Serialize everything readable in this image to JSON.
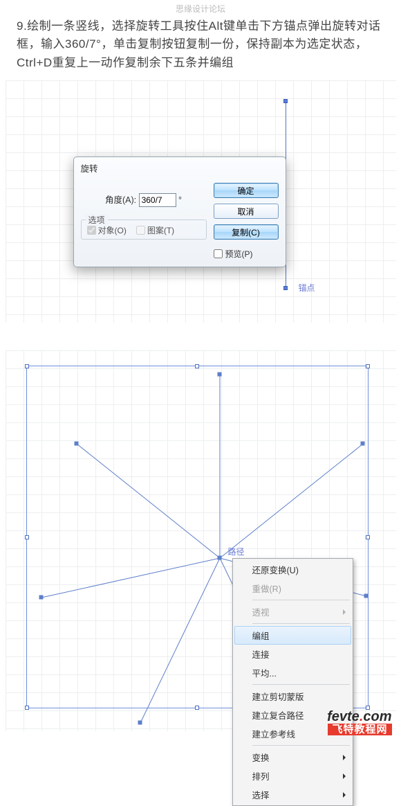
{
  "watermark": "思缘设计论坛",
  "instruction": "9.绘制一条竖线，选择旋转工具按住Alt键单击下方锚点弹出旋转对话框，输入360/7°，单击复制按钮复制一份，保持副本为选定状态，Ctrl+D重复上一动作复制余下五条并编组",
  "canvas_top": {
    "anchor_label": "锚点"
  },
  "dialog": {
    "title": "旋转",
    "angle_label": "角度(A):",
    "angle_value": "360/7",
    "angle_unit": "°",
    "options_legend": "选项",
    "object_label": "对象(O)",
    "pattern_label": "图案(T)",
    "ok": "确定",
    "cancel": "取消",
    "copy": "复制(C)",
    "preview": "预览(P)"
  },
  "canvas_bottom": {
    "path_label": "路径"
  },
  "chart_data": {
    "type": "radial-lines",
    "description": "7 line segments rotated 360/7 degrees around a common pivot",
    "count": 7,
    "angle_step_deg": 51.4286,
    "pivot": [
      310,
      300
    ],
    "length": 265
  },
  "context_menu": {
    "items": [
      {
        "label": "还原变换(U)",
        "disabled": false,
        "arrow": false
      },
      {
        "label": "重做(R)",
        "disabled": true,
        "arrow": false
      },
      {
        "sep": true
      },
      {
        "label": "透视",
        "disabled": true,
        "arrow": true
      },
      {
        "sep": true
      },
      {
        "label": "编组",
        "disabled": false,
        "arrow": false,
        "hover": true
      },
      {
        "label": "连接",
        "disabled": false,
        "arrow": false
      },
      {
        "label": "平均...",
        "disabled": false,
        "arrow": false
      },
      {
        "sep": true
      },
      {
        "label": "建立剪切蒙版",
        "disabled": false,
        "arrow": false
      },
      {
        "label": "建立复合路径",
        "disabled": false,
        "arrow": false
      },
      {
        "label": "建立参考线",
        "disabled": false,
        "arrow": false
      },
      {
        "sep": true
      },
      {
        "label": "变换",
        "disabled": false,
        "arrow": true
      },
      {
        "label": "排列",
        "disabled": false,
        "arrow": true
      },
      {
        "label": "选择",
        "disabled": false,
        "arrow": true
      }
    ]
  },
  "footer": {
    "brand_prefix": "fevte",
    "brand_suffix": "com",
    "site": "飞特教程网"
  }
}
